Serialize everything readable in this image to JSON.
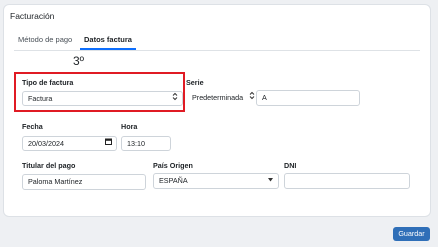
{
  "card": {
    "title": "Facturación"
  },
  "tabs": [
    {
      "label": "Método de pago",
      "active": false
    },
    {
      "label": "Datos factura",
      "active": true
    }
  ],
  "step_label": "3º",
  "form": {
    "tipo_factura": {
      "label": "Tipo de factura",
      "value": "Factura"
    },
    "serie": {
      "label": "Serie",
      "select_value": "Predeterminada",
      "input_value": "A"
    },
    "fecha": {
      "label": "Fecha",
      "value": "20/03/2024"
    },
    "hora": {
      "label": "Hora",
      "value": "13:10"
    },
    "titular": {
      "label": "Titular del pago",
      "value": "Paloma Martínez"
    },
    "pais": {
      "label": "País Origen",
      "value": "ESPAÑA"
    },
    "dni": {
      "label": "DNI",
      "value": ""
    }
  },
  "actions": {
    "save_label": "Guardar"
  },
  "colors": {
    "accent": "#0d6efd",
    "save_button": "#2f6fb8",
    "highlight": "#e01b24"
  },
  "icons": {
    "select_arrows": "updown-chevron-icon",
    "calendar": "calendar-icon",
    "dropdown": "caret-down-icon"
  }
}
